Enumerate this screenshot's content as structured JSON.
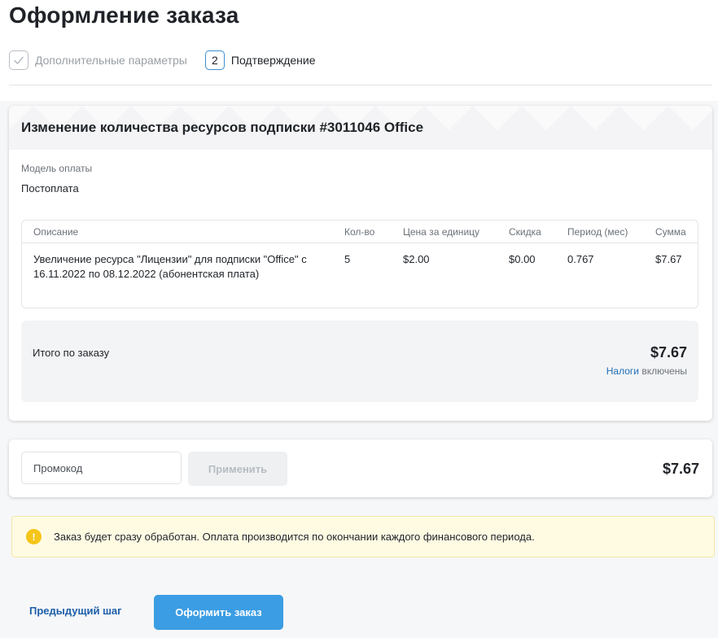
{
  "page": {
    "title": "Оформление заказа"
  },
  "steps": [
    {
      "label": "Дополнительные параметры",
      "status": "done"
    },
    {
      "number": "2",
      "label": "Подтверждение",
      "status": "active"
    }
  ],
  "order": {
    "title": "Изменение количества ресурсов подписки #3011046 Office",
    "payment_model_label": "Модель оплаты",
    "payment_model_value": "Постоплата",
    "table": {
      "headers": [
        "Описание",
        "Кол-во",
        "Цена за единицу",
        "Скидка",
        "Период (мес)",
        "Сумма"
      ],
      "rows": [
        {
          "description": "Увеличение ресурса \"Лицензии\" для подписки \"Office\" с 16.11.2022 по 08.12.2022 (абонентская плата)",
          "quantity": "5",
          "unit_price": "$2.00",
          "discount": "$0.00",
          "period": "0.767",
          "sum": "$7.67"
        }
      ]
    },
    "total_label": "Итого по заказу",
    "total_value": "$7.67",
    "tax_link": "Налоги",
    "tax_text": " включены"
  },
  "promo": {
    "placeholder": "Промокод",
    "apply_label": "Применить",
    "total": "$7.67"
  },
  "notice": {
    "icon": "info-icon",
    "text": "Заказ будет сразу обработан. Оплата производится по окончании каждого финансового периода."
  },
  "footer": {
    "prev_label": "Предыдущий шаг",
    "submit_label": "Оформить заказ"
  },
  "colors": {
    "accent": "#3b9de3",
    "link": "#1d5fa8",
    "notice_bg": "#fffbe3",
    "notice_icon": "#f5c518"
  }
}
